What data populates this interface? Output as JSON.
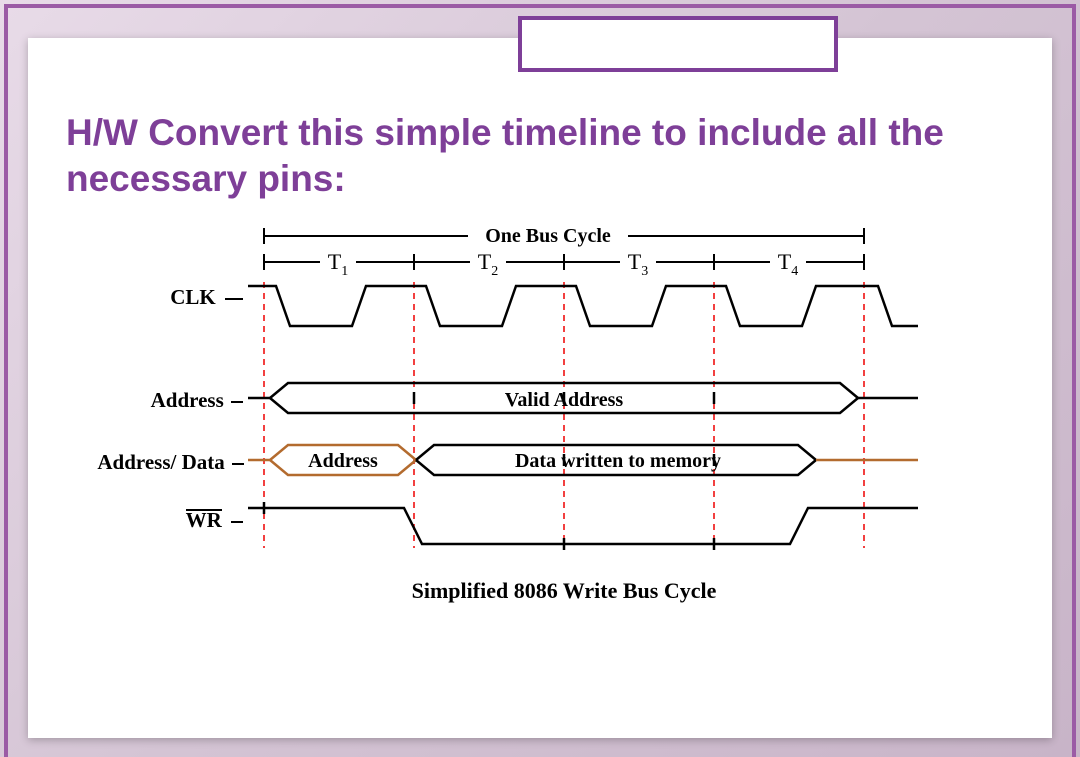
{
  "heading": "H/W Convert this simple timeline to include all the necessary pins:",
  "labels": {
    "cycle": "One Bus Cycle",
    "t1": "T",
    "t1s": "1",
    "t2": "T",
    "t2s": "2",
    "t3": "T",
    "t3s": "3",
    "t4": "T",
    "t4s": "4",
    "clk": "CLK",
    "addr": "Address",
    "ad": "Address/ Data",
    "wr": "WR",
    "valid": "Valid   Address",
    "ad_addr": "Address",
    "ad_data": "Data  written  to  memory",
    "caption": "Simplified 8086 Write Bus Cycle"
  },
  "chart_data": {
    "type": "timing-diagram",
    "title": "Simplified 8086 Write Bus Cycle",
    "cycle_label": "One Bus Cycle",
    "t_states": [
      "T1",
      "T2",
      "T3",
      "T4"
    ],
    "signals": [
      {
        "name": "CLK",
        "type": "clock",
        "periods": 4
      },
      {
        "name": "Address",
        "type": "bus",
        "segments": [
          {
            "from": "T1",
            "to": "T4",
            "value": "Valid Address"
          }
        ]
      },
      {
        "name": "Address/Data",
        "type": "bus",
        "segments": [
          {
            "from": "T1",
            "to": "T1_end",
            "value": "Address"
          },
          {
            "from": "T2",
            "to": "T4",
            "value": "Data written to memory"
          }
        ]
      },
      {
        "name": "WR",
        "type": "level",
        "levels": [
          {
            "from": "start",
            "to": "T1_end",
            "level": "high"
          },
          {
            "from": "T1_end",
            "to": "T4_mid",
            "level": "low"
          },
          {
            "from": "T4_mid",
            "to": "end",
            "level": "high"
          }
        ],
        "active_low": true
      }
    ]
  }
}
